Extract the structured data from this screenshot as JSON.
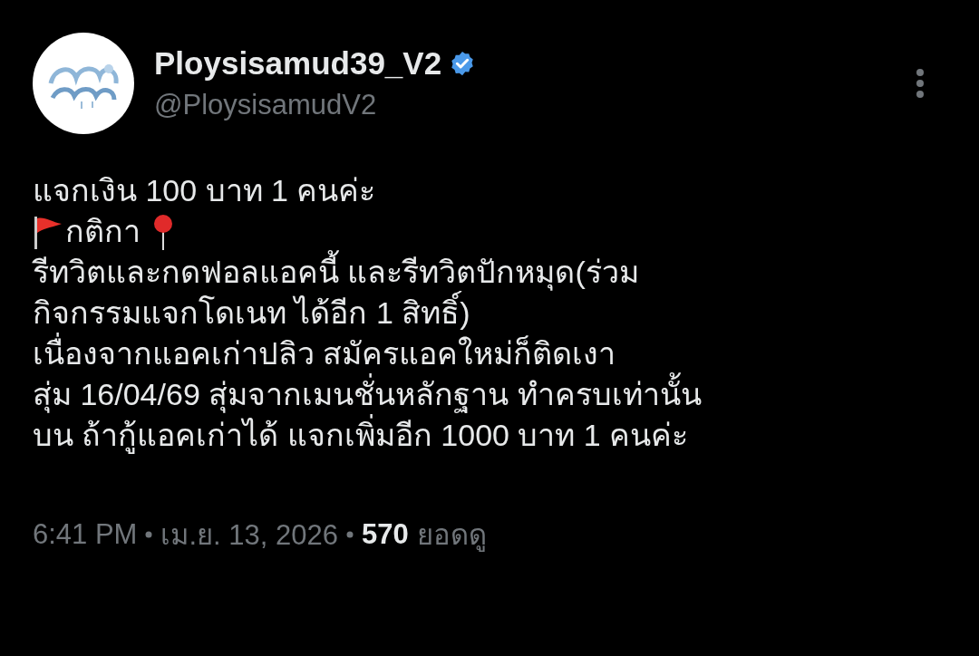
{
  "author": {
    "name": "Ploysisamud39_V2",
    "verified": true,
    "handle": "@PloysisamudV2"
  },
  "body": [
    {
      "kind": "text",
      "text": "แจกเงิน 100 บาท 1 คนค่ะ"
    },
    {
      "kind": "flag-pin",
      "text": "กติกา"
    },
    {
      "kind": "text",
      "text": "รีทวิตและกดฟอลแอคนี้ และรีทวิตปักหมุด(ร่วม"
    },
    {
      "kind": "text",
      "text": "กิจกรรมแจกโดเนท ได้อีก 1 สิทธิ์)"
    },
    {
      "kind": "text",
      "text": "เนื่องจากแอคเก่าปลิว สมัครแอคใหม่ก็ติดเงา"
    },
    {
      "kind": "text",
      "text": "สุ่ม 16/04/69 สุ่มจากเมนชั่นหลักฐาน ทำครบเท่านั้น"
    },
    {
      "kind": "text",
      "text": "บน ถ้ากู้แอคเก่าได้ แจกเพิ่มอีก 1000 บาท 1 คนค่ะ"
    }
  ],
  "meta": {
    "time": "6:41 PM",
    "date": "เม.ย. 13, 2026",
    "views": "570",
    "views_label": "ยอดดู"
  }
}
